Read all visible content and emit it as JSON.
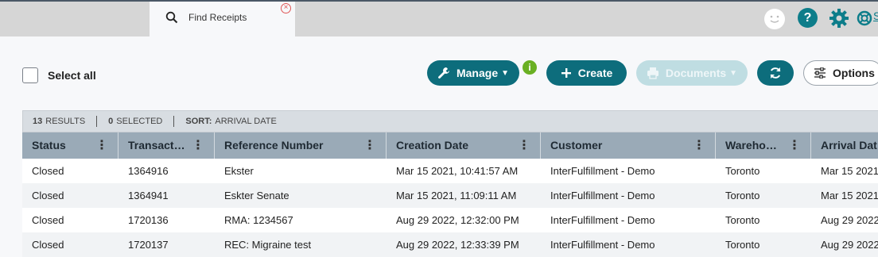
{
  "tab": {
    "label": "Find Receipts",
    "close": "×"
  },
  "top": {
    "help": "?",
    "link": "S"
  },
  "toolbar": {
    "select_all": "Select all",
    "manage": "Manage",
    "info": "i",
    "create": "Create",
    "documents": "Documents",
    "options": "Options"
  },
  "summary": {
    "results_count": "13",
    "results_label": "RESULTS",
    "selected_count": "0",
    "selected_label": "SELECTED",
    "sort_label": "SORT:",
    "sort_value": "ARRIVAL DATE"
  },
  "columns": [
    "Status",
    "Transact…",
    "Reference Number",
    "Creation Date",
    "Customer",
    "Wareho…",
    "Arrival Dat"
  ],
  "rows": [
    [
      "Closed",
      "1364916",
      "Ekster",
      "Mar 15 2021, 10:41:57 AM",
      "InterFulfillment - Demo",
      "Toronto",
      "Mar 15 2021"
    ],
    [
      "Closed",
      "1364941",
      "Eskter Senate",
      "Mar 15 2021, 11:09:11 AM",
      "InterFulfillment - Demo",
      "Toronto",
      "Mar 15 2021"
    ],
    [
      "Closed",
      "1720136",
      "RMA: 1234567",
      "Aug 29 2022, 12:32:00 PM",
      "InterFulfillment - Demo",
      "Toronto",
      "Aug 29 2022"
    ],
    [
      "Closed",
      "1720137",
      "REC: Migraine test",
      "Aug 29 2022, 12:33:39 PM",
      "InterFulfillment - Demo",
      "Toronto",
      "Aug 29 2022"
    ]
  ]
}
